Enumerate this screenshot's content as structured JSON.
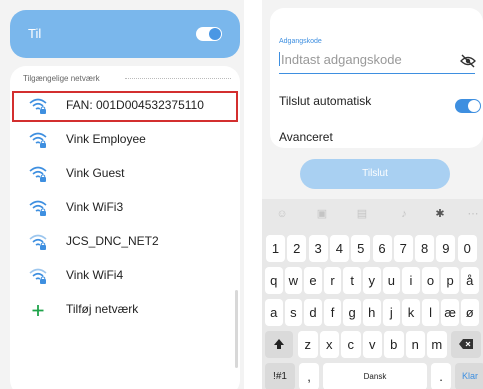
{
  "left": {
    "wifi_toggle": {
      "label": "Til",
      "on": true
    },
    "section_header": "Tilgængelige netværk",
    "networks": [
      {
        "name": "FAN: 001D004532375110",
        "selected": true
      },
      {
        "name": "Vink Employee",
        "selected": false
      },
      {
        "name": "Vink Guest",
        "selected": false
      },
      {
        "name": "Vink WiFi3",
        "selected": false
      },
      {
        "name": "JCS_DNC_NET2",
        "selected": false
      },
      {
        "name": "Vink WiFi4",
        "selected": false
      }
    ],
    "add_network": "Tilføj netværk"
  },
  "right": {
    "password_label": "Adgangskode",
    "password_placeholder": "Indtast adgangskode",
    "password_placeholder_rest": "ndtast adgangskode",
    "password_first_char": "I",
    "auto_connect_label": "Tilslut automatisk",
    "auto_connect_on": true,
    "advanced_label": "Avanceret",
    "connect_label": "Tilslut",
    "keyboard": {
      "row1": [
        "1",
        "2",
        "3",
        "4",
        "5",
        "6",
        "7",
        "8",
        "9",
        "0"
      ],
      "row2": [
        "q",
        "w",
        "e",
        "r",
        "t",
        "y",
        "u",
        "i",
        "o",
        "p",
        "å"
      ],
      "row3": [
        "a",
        "s",
        "d",
        "f",
        "g",
        "h",
        "j",
        "k",
        "l",
        "æ",
        "ø"
      ],
      "row4": [
        "z",
        "x",
        "c",
        "v",
        "b",
        "n",
        "m"
      ],
      "symbols_key": "!#1",
      "comma_key": ",",
      "space_label": "Dansk",
      "period_key": ".",
      "enter_label": "Klar"
    }
  },
  "colors": {
    "accent": "#3e8fe0",
    "toggle_card": "#7ab7ec",
    "highlight_border": "#d32f2f",
    "add_plus": "#1fa34a"
  }
}
